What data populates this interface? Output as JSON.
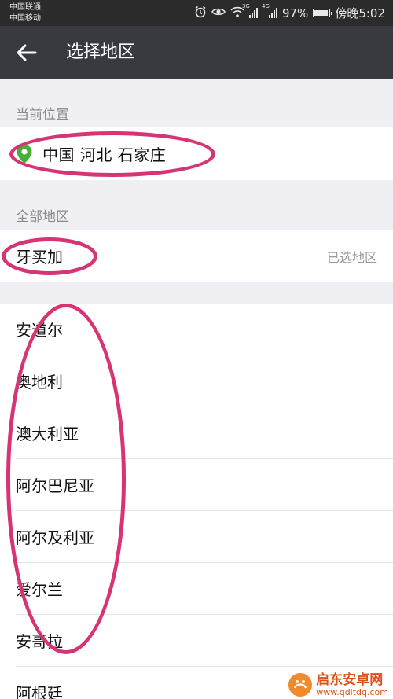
{
  "status_bar": {
    "carrier_1": "中国联通",
    "carrier_2": "中国移动",
    "network_1": "3G",
    "network_2": "4G",
    "battery": "97%",
    "time": "傍晚5:02",
    "icons": [
      "alarm-icon",
      "eye-icon",
      "wifi-icon",
      "signal-icon",
      "battery-icon"
    ]
  },
  "nav": {
    "back_icon": "arrow-left-icon",
    "title": "选择地区"
  },
  "current_location": {
    "section_label": "当前位置",
    "icon": "location-pin-icon",
    "icon_color": "#44b035",
    "value": "中国 河北 石家庄"
  },
  "all_regions": {
    "section_label": "全部地区",
    "selected": {
      "name": "牙买加",
      "tag": "已选地区"
    },
    "items": [
      "安道尔",
      "奥地利",
      "澳大利亚",
      "阿尔巴尼亚",
      "阿尔及利亚",
      "爱尔兰",
      "安哥拉",
      "阿根廷"
    ]
  },
  "annotation_color": "#d63474",
  "watermark": {
    "title": "启东安卓网",
    "url": "www.qdltdq.com"
  }
}
